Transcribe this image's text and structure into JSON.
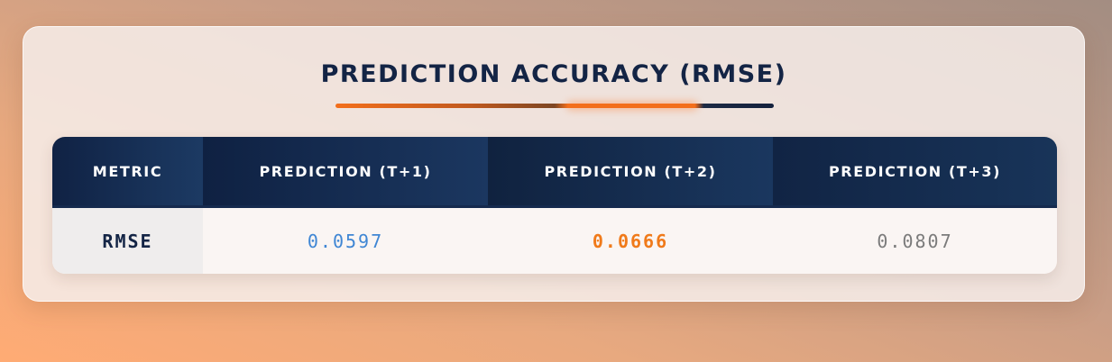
{
  "chart_data": {
    "type": "table",
    "title": "PREDICTION ACCURACY (RMSE)",
    "columns": [
      "METRIC",
      "PREDICTION (T+1)",
      "PREDICTION (T+2)",
      "PREDICTION (T+3)"
    ],
    "rows": [
      {
        "metric": "RMSE",
        "values": [
          "0.0597",
          "0.0666",
          "0.0807"
        ]
      }
    ]
  },
  "colors": {
    "header_navy": "#132445",
    "accent_orange": "#f36f1c",
    "value_blue": "#3f86d4",
    "value_orange": "#f07a1a",
    "value_gray": "#7b7b7b"
  }
}
